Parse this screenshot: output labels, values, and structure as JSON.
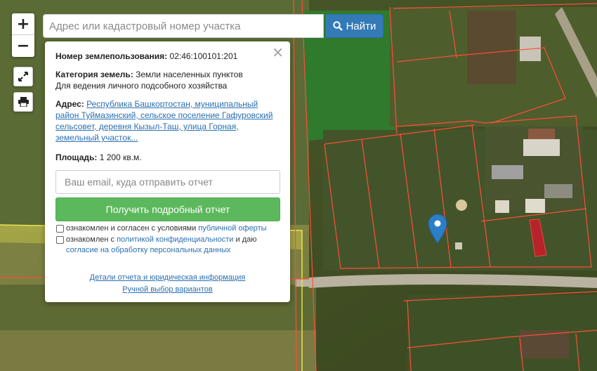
{
  "map": {
    "zoom_in": "+",
    "zoom_out": "−",
    "colors": {
      "parcel_border": "#ff4d3a",
      "selected_parcel": "#cc1b2b",
      "marker": "#2c7fc6",
      "yellow_zone": "#e8e24a"
    }
  },
  "search": {
    "placeholder": "Адрес или кадастровый номер участка",
    "button_label": "Найти",
    "button_icon": "search-icon"
  },
  "popup": {
    "number_label": "Номер землепользования:",
    "number_value": "02:46:100101:201",
    "category_label": "Категория земель:",
    "category_value": "Земли населенных пунктов",
    "usage_value": "Для ведения личного подсобного хозяйства",
    "address_label": "Адрес:",
    "address_value": "Республика Башкортостан, муниципальный район Туймазинский, сельское поселение Гафуровский сельсовет, деревня Кызыл-Таш, улица Горная, земельный участок...",
    "area_label": "Площадь:",
    "area_value": "1 200 кв.м.",
    "email_placeholder": "Ваш email, куда отправить отчет",
    "report_button": "Получить подробный отчет",
    "consent1_text": "ознакомлен и согласен с условиями",
    "consent1_link": "публичной оферты",
    "consent2_text": "ознакомлен с",
    "consent2_link": "политикой конфиденциальности",
    "consent2_mid": "и даю",
    "consent2_link2": "согласие на обработку персональных данных",
    "details_link": "Детали отчета и юридическая информация",
    "manual_link": "Ручной выбор вариантов",
    "close": "×"
  }
}
